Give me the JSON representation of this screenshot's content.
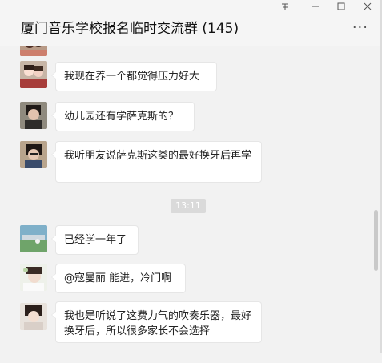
{
  "window": {
    "title": "厦门音乐学校报名临时交流群 (145)",
    "pin_icon": "pin-icon",
    "minimize_icon": "minimize-icon",
    "maximize_icon": "maximize-icon",
    "close_icon": "close-icon",
    "more_label": "···"
  },
  "chat": {
    "timestamp": "13:11",
    "messages": [
      {
        "text": "我现在养一个都觉得压力好大"
      },
      {
        "text": "幼儿园还有学萨克斯的？"
      },
      {
        "text": "我听朋友说萨克斯这类的最好换牙后再学"
      },
      {
        "text": "已经学一年了"
      },
      {
        "text": "@寇曼丽 能进，冷门啊"
      },
      {
        "text": "我也是听说了这费力气的吹奏乐器，最好换牙后，所以很多家长不会选择"
      }
    ]
  }
}
